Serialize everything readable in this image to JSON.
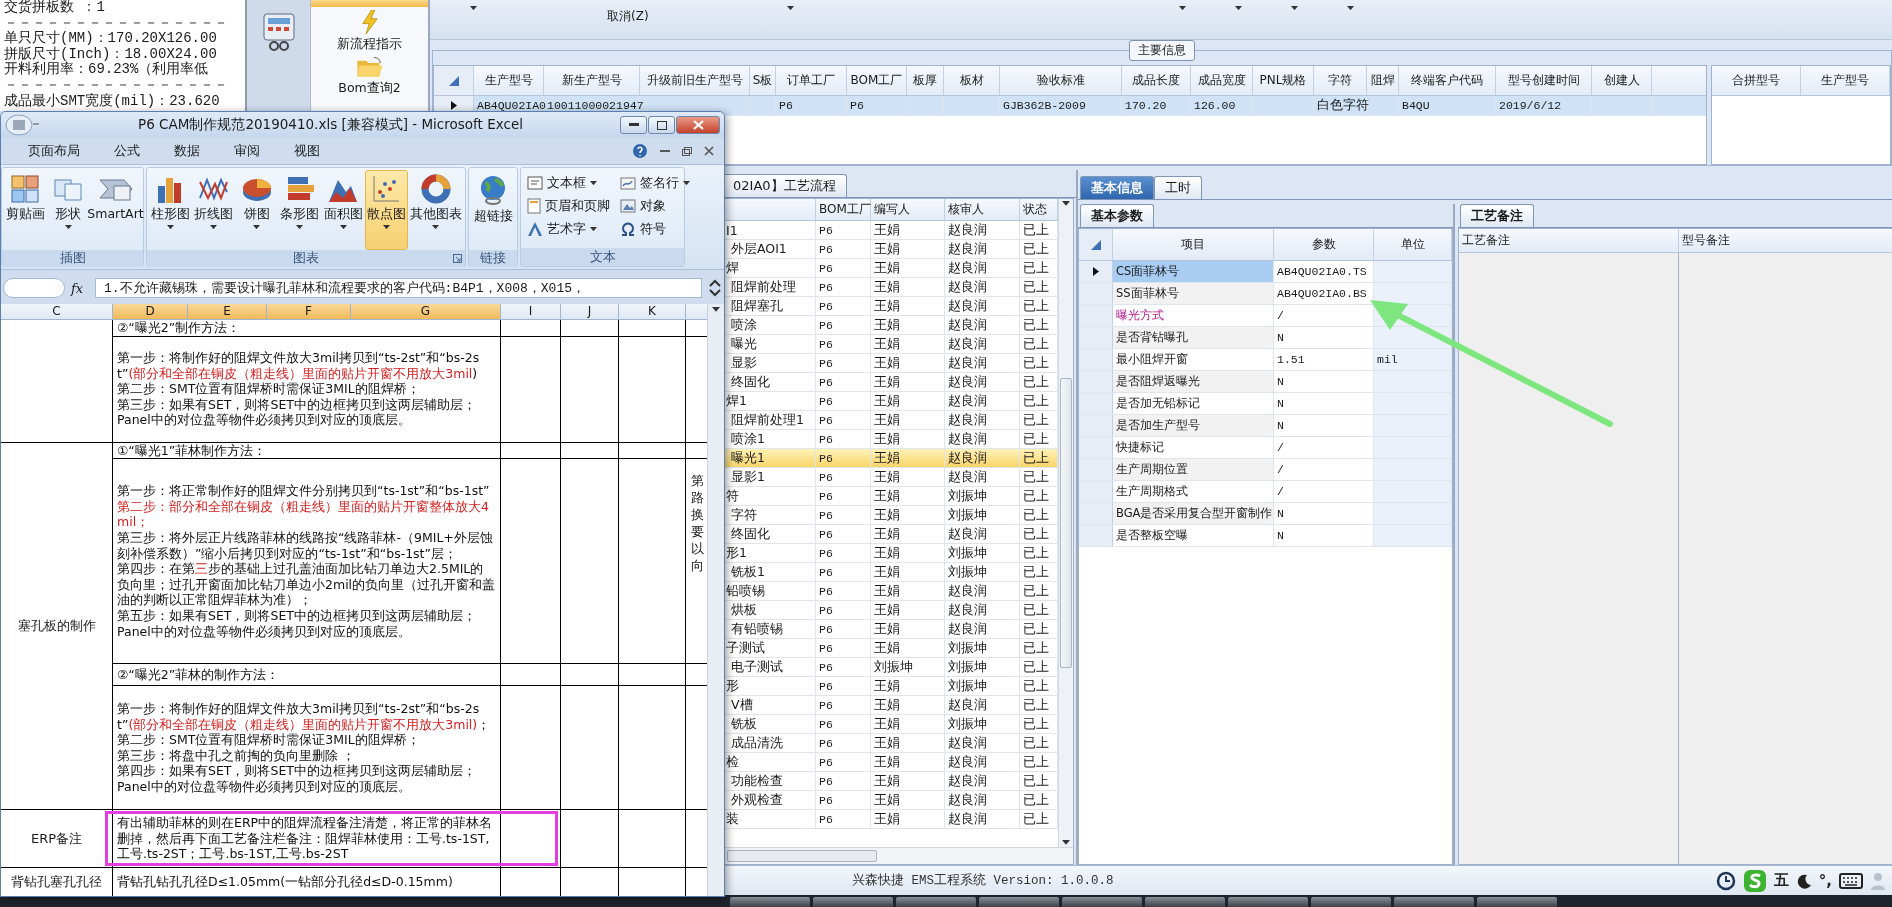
{
  "notepad": {
    "lines": [
      "交货拼板数 ：1",
      "－－－－－－－－－－－－－－－－",
      "单只尺寸(MM)：170.20X126.00",
      "拼版尺寸(Inch)：18.00X24.00",
      "开料利用率：69.23%（利用率低",
      "－－－－－－－－－－－－－－－－",
      "成品最小SMT宽度(mil)：23.620"
    ]
  },
  "nav": {
    "items": [
      {
        "selected": true
      },
      {
        "label": "新流程指示",
        "selected": false
      },
      {
        "label": "Bom查询2",
        "selected": false
      }
    ]
  },
  "toolbar": {
    "items": [
      {
        "label": "取消(Z)"
      }
    ]
  },
  "main_info": {
    "title": "主要信息",
    "columns": [
      "生产型号",
      "新生产型号",
      "升级前旧生产型号",
      "S板",
      "订单工厂",
      "BOM工厂",
      "板厚",
      "板材",
      "验收标准",
      "成品长度",
      "成品宽度",
      "PNL规格",
      "字符",
      "阻焊",
      "终端客户代码",
      "型号创建时间",
      "创建人"
    ],
    "rows": [
      {
        "selected": true,
        "values": {
          "0": "AB4QU02IA0",
          "1": "10011000021947",
          "4": "P6",
          "5": "P6",
          "8": "GJB362B-2009",
          "9": "170.20",
          "10": "126.00",
          "12": "白色字符",
          "14": "B4QU",
          "15": "2019/6/12"
        }
      }
    ],
    "side_columns": [
      "合拼型号",
      "生产型号"
    ]
  },
  "flow": {
    "tab": "02IA0】工艺流程",
    "columns": [
      "BOM工厂",
      "编写人",
      "核审人",
      "状态"
    ],
    "items": [
      {
        "name": "I1",
        "bom": "P6",
        "writer": "王娟",
        "reviewer": "赵良润",
        "status": "已上",
        "selected": false,
        "children": [
          {
            "name": "外层AOI1",
            "bom": "P6",
            "writer": "王娟",
            "reviewer": "赵良润",
            "status": "已上",
            "selected": false
          }
        ]
      },
      {
        "name": "焊",
        "bom": "P6",
        "writer": "王娟",
        "reviewer": "赵良润",
        "status": "已上",
        "selected": false,
        "children": [
          {
            "name": "阻焊前处理",
            "bom": "P6",
            "writer": "王娟",
            "reviewer": "赵良润",
            "status": "已上",
            "selected": false
          },
          {
            "name": "阻焊塞孔",
            "bom": "P6",
            "writer": "王娟",
            "reviewer": "赵良润",
            "status": "已上",
            "selected": false
          },
          {
            "name": "喷涂",
            "bom": "P6",
            "writer": "王娟",
            "reviewer": "赵良润",
            "status": "已上",
            "selected": false
          },
          {
            "name": "曝光",
            "bom": "P6",
            "writer": "王娟",
            "reviewer": "赵良润",
            "status": "已上",
            "selected": false
          },
          {
            "name": "显影",
            "bom": "P6",
            "writer": "王娟",
            "reviewer": "赵良润",
            "status": "已上",
            "selected": false
          },
          {
            "name": "终固化",
            "bom": "P6",
            "writer": "王娟",
            "reviewer": "赵良润",
            "status": "已上",
            "selected": false
          }
        ]
      },
      {
        "name": "焊1",
        "bom": "P6",
        "writer": "王娟",
        "reviewer": "赵良润",
        "status": "已上",
        "selected": false,
        "children": [
          {
            "name": "阻焊前处理1",
            "bom": "P6",
            "writer": "王娟",
            "reviewer": "赵良润",
            "status": "已上",
            "selected": false
          },
          {
            "name": "喷涂1",
            "bom": "P6",
            "writer": "王娟",
            "reviewer": "赵良润",
            "status": "已上",
            "selected": false
          },
          {
            "name": "曝光1",
            "bom": "P6",
            "writer": "王娟",
            "reviewer": "赵良润",
            "status": "已上",
            "selected": true
          },
          {
            "name": "显影1",
            "bom": "P6",
            "writer": "王娟",
            "reviewer": "赵良润",
            "status": "已上",
            "selected": false
          }
        ]
      },
      {
        "name": "符",
        "bom": "P6",
        "writer": "王娟",
        "reviewer": "刘振坤",
        "status": "已上",
        "selected": false,
        "children": [
          {
            "name": "字符",
            "bom": "P6",
            "writer": "王娟",
            "reviewer": "刘振坤",
            "status": "已上",
            "selected": false
          },
          {
            "name": "终固化",
            "bom": "P6",
            "writer": "王娟",
            "reviewer": "赵良润",
            "status": "已上",
            "selected": false
          }
        ]
      },
      {
        "name": "形1",
        "bom": "P6",
        "writer": "王娟",
        "reviewer": "刘振坤",
        "status": "已上",
        "selected": false,
        "children": [
          {
            "name": "铣板1",
            "bom": "P6",
            "writer": "王娟",
            "reviewer": "刘振坤",
            "status": "已上",
            "selected": false
          }
        ]
      },
      {
        "name": "铅喷锡",
        "bom": "P6",
        "writer": "王娟",
        "reviewer": "赵良润",
        "status": "已上",
        "selected": false,
        "children": [
          {
            "name": "烘板",
            "bom": "P6",
            "writer": "王娟",
            "reviewer": "赵良润",
            "status": "已上",
            "selected": false
          },
          {
            "name": "有铅喷锡",
            "bom": "P6",
            "writer": "王娟",
            "reviewer": "赵良润",
            "status": "已上",
            "selected": false
          }
        ]
      },
      {
        "name": "子测试",
        "bom": "P6",
        "writer": "王娟",
        "reviewer": "刘振坤",
        "status": "已上",
        "selected": false,
        "children": [
          {
            "name": "电子测试",
            "bom": "P6",
            "writer": "刘振坤",
            "reviewer": "刘振坤",
            "status": "已上",
            "selected": false
          }
        ]
      },
      {
        "name": "形",
        "bom": "P6",
        "writer": "王娟",
        "reviewer": "刘振坤",
        "status": "已上",
        "selected": false,
        "children": [
          {
            "name": "V槽",
            "bom": "P6",
            "writer": "王娟",
            "reviewer": "赵良润",
            "status": "已上",
            "selected": false
          },
          {
            "name": "铣板",
            "bom": "P6",
            "writer": "王娟",
            "reviewer": "刘振坤",
            "status": "已上",
            "selected": false
          },
          {
            "name": "成品清洗",
            "bom": "P6",
            "writer": "王娟",
            "reviewer": "赵良润",
            "status": "已上",
            "selected": false
          }
        ]
      },
      {
        "name": "检",
        "bom": "P6",
        "writer": "王娟",
        "reviewer": "赵良润",
        "status": "已上",
        "selected": false,
        "children": [
          {
            "name": "功能检查",
            "bom": "P6",
            "writer": "王娟",
            "reviewer": "赵良润",
            "status": "已上",
            "selected": false
          },
          {
            "name": "外观检查",
            "bom": "P6",
            "writer": "王娟",
            "reviewer": "赵良润",
            "status": "已上",
            "selected": false
          }
        ]
      },
      {
        "name": "装",
        "bom": "P6",
        "writer": "王娟",
        "reviewer": "赵良润",
        "status": "已上",
        "selected": false
      }
    ]
  },
  "detail_tabs": [
    {
      "label": "基本信息",
      "selected": true
    },
    {
      "label": "工时",
      "selected": false
    }
  ],
  "basic": {
    "tab": "基本参数",
    "columns": [
      "项目",
      "参数",
      "单位"
    ],
    "rows": [
      {
        "item": "CS面菲林号",
        "value": "AB4QU02IA0.TS",
        "selected": true,
        "highlighted": false
      },
      {
        "item": "SS面菲林号",
        "value": "AB4QU02IA0.BS",
        "selected": false,
        "highlighted": false
      },
      {
        "item": "曝光方式",
        "value": "/",
        "selected": false,
        "highlighted": true
      },
      {
        "item": "是否背钻曝孔",
        "value": "N",
        "selected": false,
        "highlighted": false
      },
      {
        "item": "最小阻焊开窗",
        "value": "1.51",
        "unit": "mil",
        "selected": false,
        "highlighted": false
      },
      {
        "item": "是否阻焊返曝光",
        "value": "N",
        "selected": false,
        "highlighted": false
      },
      {
        "item": "是否加无铅标记",
        "value": "N",
        "selected": false,
        "highlighted": false
      },
      {
        "item": "是否加生产型号",
        "value": "N",
        "selected": false,
        "highlighted": false
      },
      {
        "item": "快捷标记",
        "value": "/",
        "selected": false,
        "highlighted": false
      },
      {
        "item": "生产周期位置",
        "value": "/",
        "selected": false,
        "highlighted": false
      },
      {
        "item": "生产周期格式",
        "value": "/",
        "selected": false,
        "highlighted": false
      },
      {
        "item": "BGA是否采用复合型开窗制作",
        "value": "N",
        "selected": false,
        "highlighted": false
      },
      {
        "item": "是否整板空曝",
        "value": "N",
        "selected": false,
        "highlighted": false
      }
    ]
  },
  "remarks": {
    "tab": "工艺备注",
    "columns": [
      "工艺备注",
      "型号备注"
    ]
  },
  "status_bar": {
    "text": "兴森快捷 EMS工程系统 Version: 1.0.0.8",
    "tray": [
      "五",
      "°,"
    ]
  },
  "excel": {
    "title": "P6 CAM制作规范20190410.xls  [兼容模式] - Microsoft Excel",
    "tabs": [
      {
        "label": "页面布局",
        "selected": false
      },
      {
        "label": "公式",
        "selected": false
      },
      {
        "label": "数据",
        "selected": false
      },
      {
        "label": "审阅",
        "selected": false
      },
      {
        "label": "视图",
        "selected": false
      }
    ],
    "groups": [
      {
        "label": "插图",
        "kind": "large",
        "dialog_launcher": false,
        "buttons": [
          {
            "label": "剪贴画",
            "dropdown": false,
            "selected": false
          },
          {
            "label": "形状",
            "dropdown": true,
            "selected": false
          },
          {
            "label": "SmartArt",
            "dropdown": false,
            "selected": false
          }
        ]
      },
      {
        "label": "图表",
        "kind": "large",
        "dialog_launcher": true,
        "buttons": [
          {
            "label": "柱形图",
            "dropdown": true,
            "selected": false
          },
          {
            "label": "折线图",
            "dropdown": true,
            "selected": false
          },
          {
            "label": "饼图",
            "dropdown": true,
            "selected": false
          },
          {
            "label": "条形图",
            "dropdown": true,
            "selected": false
          },
          {
            "label": "面积图",
            "dropdown": true,
            "selected": false
          },
          {
            "label": "散点图",
            "dropdown": true,
            "selected": true
          },
          {
            "label": "其他图表",
            "dropdown": true,
            "selected": false
          }
        ]
      },
      {
        "label": "链接",
        "kind": "large",
        "dialog_launcher": false,
        "buttons": [
          {
            "label": "超链接",
            "dropdown": false,
            "selected": false
          }
        ]
      },
      {
        "label": "文本",
        "kind": "small",
        "dialog_launcher": false,
        "buttons": [
          {
            "label": "文本框",
            "dropdown": true,
            "selected": false
          },
          {
            "label": "签名行",
            "dropdown": true,
            "selected": false
          },
          {
            "label": "页眉和页脚",
            "dropdown": false,
            "selected": false
          },
          {
            "label": "对象",
            "dropdown": false,
            "selected": false
          },
          {
            "label": "艺术字",
            "dropdown": true,
            "selected": false
          },
          {
            "label": "符号",
            "dropdown": false,
            "selected": false
          }
        ]
      }
    ],
    "function_label": "fx",
    "formula": "1.不允许藏锡珠，需要设计曝孔菲林和流程要求的客户代码:B4P1，X008，X015，",
    "columns": [
      {
        "label": "C",
        "selected": false
      },
      {
        "label": "D",
        "selected": true
      },
      {
        "label": "E",
        "selected": true
      },
      {
        "label": "F",
        "selected": true
      },
      {
        "label": "G",
        "selected": true
      },
      {
        "label": "I",
        "selected": false
      },
      {
        "label": "J",
        "selected": false
      },
      {
        "label": "K",
        "selected": false
      }
    ],
    "groups_of_rows": [
      {
        "rows": [
          {
            "framed": false,
            "paragraphs": [
              [
                {
                  "text": "②“曝光2”制作方法：",
                  "red": false
                }
              ]
            ]
          },
          {
            "framed": false,
            "paragraphs": [
              [
                {
                  "text": "第一步：将制作好的阻焊文件放大3mil拷贝到“ts-2st”和“bs-2st”",
                  "red": false
                },
                {
                  "text": "(部分和全部在铜皮（粗走线）里面的贴片开窗不用放大3mil",
                  "red": true
                },
                {
                  "text": ")",
                  "red": false
                }
              ],
              [
                {
                  "text": "第二步：SMT位置有阻焊桥时需保证3MIL的阻焊桥；",
                  "red": false
                }
              ],
              [
                {
                  "text": "第三步：如果有SET，则将SET中的边框拷贝到这两层辅助层；",
                  "red": false
                }
              ],
              [
                {
                  "text": "Panel中的对位盘等物件必须拷贝到对应的顶底层。",
                  "red": false
                }
              ]
            ]
          }
        ]
      },
      {
        "label": "塞孔板的制作",
        "rows": [
          {
            "framed": false,
            "paragraphs": [
              [
                {
                  "text": "①“曝光1”菲林制作方法：",
                  "red": false
                }
              ]
            ]
          },
          {
            "framed": false,
            "side_note": "第路换要以向",
            "paragraphs": [
              [
                {
                  "text": "第一步：将正常制作好的阻焊文件分别拷贝到“ts-1st”和“bs-1st”",
                  "red": false
                }
              ],
              [
                {
                  "text": "第二步：部分和全部在铜皮（粗走线）里面的贴片开窗整体放大4mil；",
                  "red": true
                }
              ],
              [
                {
                  "text": "第三步：将外层正片线路菲林的线路按“线路菲林-（9MIL+外层蚀刻补偿系数）”缩小后拷贝到对应的“ts-1st”和“bs-1st”层；",
                  "red": false
                }
              ],
              [
                {
                  "text": "第四步：在第",
                  "red": false
                },
                {
                  "text": "三",
                  "red": true
                },
                {
                  "text": "步的基础上过孔盖油面加比钻刀单边大2.5MIL的负向里；过孔开窗面加比钻刀单边小2mil的负向里（过孔开窗和盖油的判断以正常阻焊菲林为准）；",
                  "red": false
                }
              ],
              [
                {
                  "text": "第五步：如果有SET，则将SET中的边框拷贝到这两层辅助层；",
                  "red": false
                }
              ],
              [
                {
                  "text": "Panel中的对位盘等物件必须拷贝到对应的顶底层。",
                  "red": false
                }
              ]
            ]
          },
          {
            "framed": false,
            "paragraphs": [
              [
                {
                  "text": "②“曝光2”菲林的制作方法：",
                  "red": false
                }
              ]
            ]
          },
          {
            "framed": false,
            "paragraphs": [
              [
                {
                  "text": "第一步：将制作好的阻焊文件放大3mil拷贝到“ts-2st”和“bs-2st”",
                  "red": false
                },
                {
                  "text": "(部分和全部在铜皮（粗走线）里面的贴片开窗不用放大3mil)",
                  "red": true
                },
                {
                  "text": "；",
                  "red": false
                }
              ],
              [
                {
                  "text": "第二步：SMT位置有阻焊桥时需保证3MIL的阻焊桥；",
                  "red": false
                }
              ],
              [
                {
                  "text": "第三步：将盘中孔之前掏的负向里删除 ；",
                  "red": false
                }
              ],
              [
                {
                  "text": "第四步：如果有SET，则将SET中的边框拷贝到这两层辅助层；",
                  "red": false
                }
              ],
              [
                {
                  "text": "Panel中的对位盘等物件必须拷贝到对应的顶底层。",
                  "red": false
                }
              ]
            ]
          }
        ]
      },
      {
        "label": "ERP备注",
        "rows": [
          {
            "framed": true,
            "paragraphs": [
              [
                {
                  "text": "有出辅助菲林的则在ERP中的阻焊流程备注清楚，将正常的菲林名删掉，然后再下面工艺备注栏备注：阻焊菲林使用：工号.ts-1ST,工号.ts-2ST；工号.bs-1ST,工号.bs-2ST",
                  "red": false
                }
              ]
            ]
          }
        ]
      },
      {
        "label": "背钻孔塞孔孔径",
        "rows": [
          {
            "framed": false,
            "paragraphs": [
              [
                {
                  "text": "背钻孔钻孔孔径D≤1.05mm(一钻部分孔径d≤D-0.15mm)",
                  "red": false
                }
              ]
            ]
          }
        ]
      }
    ]
  }
}
